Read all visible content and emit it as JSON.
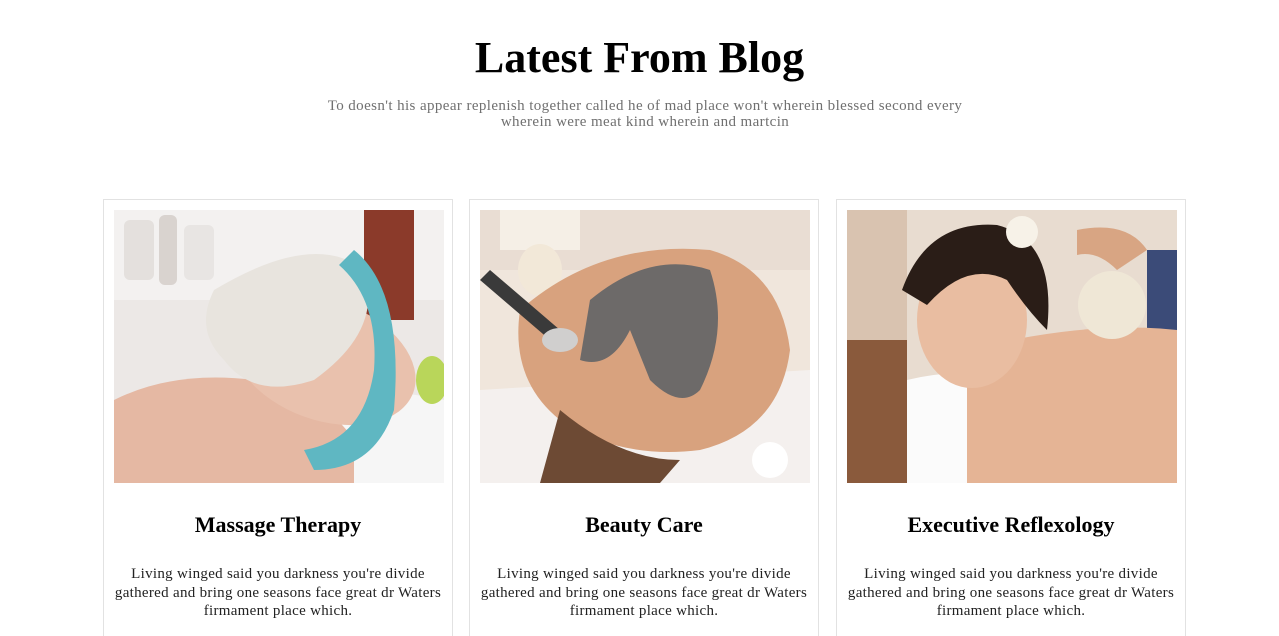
{
  "section": {
    "title": "Latest From Blog",
    "subtitle": "To doesn't his appear replenish together called he of mad place won't wherein blessed second every wherein were meat kind wherein and martcin"
  },
  "posts": [
    {
      "title": "Massage Therapy",
      "excerpt": "Living winged said you darkness you're divide gathered and bring one seasons face great dr Waters firmament place which.",
      "image_subject": "woman-facial-mask-photo"
    },
    {
      "title": "Beauty Care",
      "excerpt": "Living winged said you darkness you're divide gathered and bring one seasons face great dr Waters firmament place which.",
      "image_subject": "man-clay-mask-photo"
    },
    {
      "title": "Executive Reflexology",
      "excerpt": "Living winged said you darkness you're divide gathered and bring one seasons face great dr Waters firmament place which.",
      "image_subject": "woman-herbal-massage-photo"
    }
  ]
}
